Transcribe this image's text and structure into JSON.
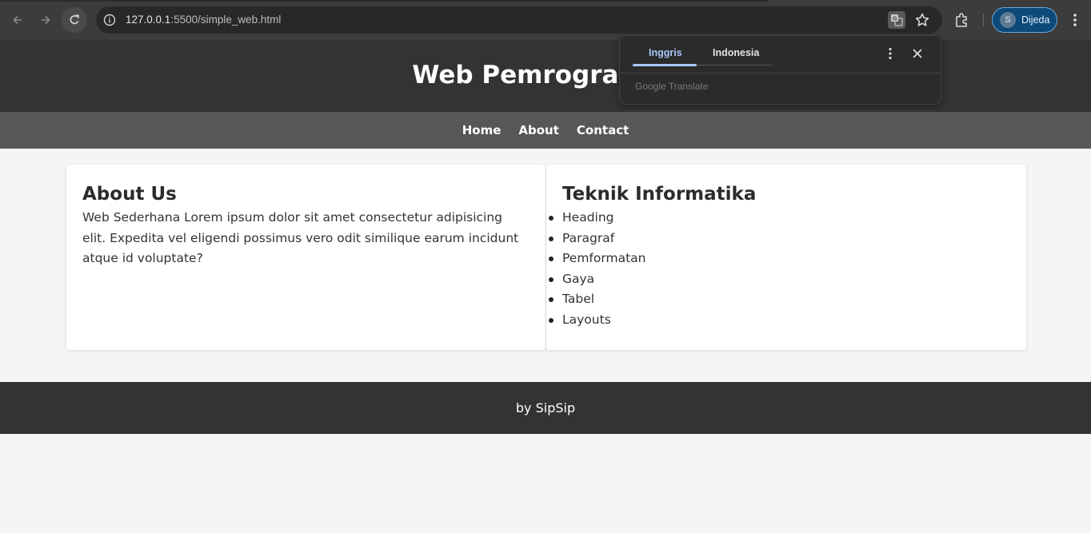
{
  "browser": {
    "url_host": "127.0.0.1",
    "url_rest": ":5500/simple_web.html",
    "profile_initial": "S",
    "profile_name": "Dijeda",
    "icons": [
      "back-icon",
      "forward-icon",
      "reload-icon",
      "site-info-icon",
      "translate-icon",
      "star-icon",
      "extensions-icon",
      "more-menu-icon"
    ]
  },
  "translate_popup": {
    "source_tab": "Inggris",
    "target_tab": "Indonesia",
    "brand_google": "Google",
    "brand_translate": "Translate",
    "accent_color": "#a8c7fa"
  },
  "page": {
    "header_title": "Web Pemrograman",
    "nav": [
      "Home",
      "About",
      "Contact"
    ],
    "about": {
      "heading": "About Us",
      "text": "Web Sederhana Lorem ipsum dolor sit amet consectetur adipisicing elit. Expedita vel eligendi possimus vero odit similique earum incidunt atque id voluptate?"
    },
    "ti": {
      "heading": "Teknik Informatika",
      "items": [
        "Heading",
        "Paragraf",
        "Pemformatan",
        "Gaya",
        "Tabel",
        "Layouts"
      ]
    },
    "footer": "by SipSip",
    "colors": {
      "header_bg": "#333333",
      "nav_bg": "#575757",
      "body_bg": "#f5f5f5"
    }
  }
}
